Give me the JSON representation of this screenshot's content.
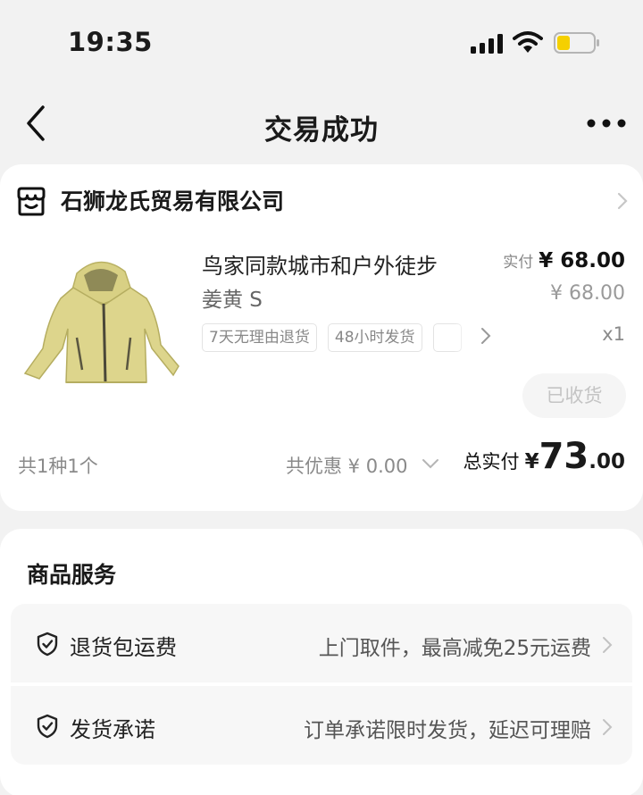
{
  "status_bar": {
    "time": "19:35"
  },
  "nav": {
    "title": "交易成功"
  },
  "shop": {
    "name": "石狮龙氏贸易有限公司"
  },
  "product": {
    "title": "鸟家同款城市和户外徒步",
    "variant": "姜黄 S",
    "tags": [
      "7天无理由退货",
      "48小时发货"
    ],
    "actual_price_label": "实付",
    "actual_price": "¥ 68.00",
    "original_price": "¥ 68.00",
    "quantity": "x1",
    "image_color": "#dcd48a"
  },
  "actions": {
    "received_label": "已收货"
  },
  "summary": {
    "count": "共1种1个",
    "discount": "共优惠 ¥ 0.00",
    "total_label": "总实付",
    "total_currency": "¥",
    "total_integer": "73",
    "total_decimal": ".00"
  },
  "services": {
    "title": "商品服务",
    "items": [
      {
        "name": "退货包运费",
        "description": "上门取件，最高减免25元运费",
        "icon": "shield-check-icon"
      },
      {
        "name": "发货承诺",
        "description": "订单承诺限时发货，延迟可理赔",
        "icon": "shield-check-icon"
      }
    ]
  },
  "colors": {
    "background": "#f2f2f2",
    "card": "#ffffff",
    "battery_fill": "#f5d000"
  }
}
